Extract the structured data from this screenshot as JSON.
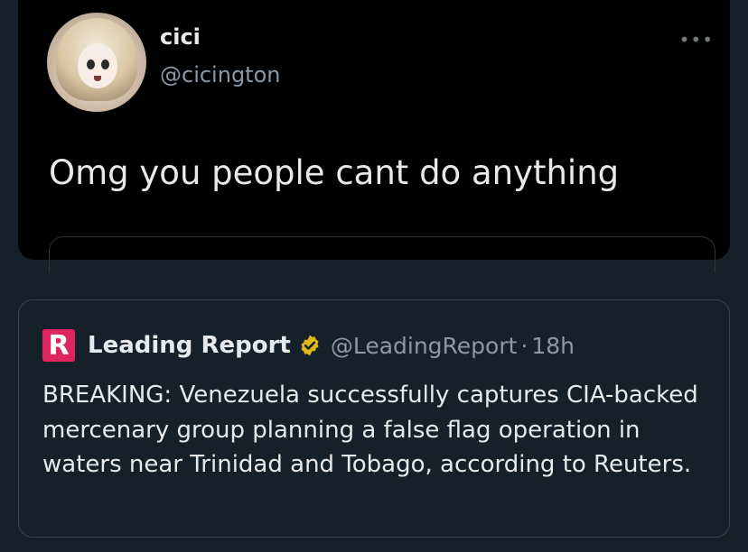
{
  "main_tweet": {
    "display_name": "cici",
    "handle": "@cicington",
    "text": "Omg you people cant do anything",
    "more_icon": "more-horizontal-icon"
  },
  "quoted_tweet": {
    "logo_icon": "leading-report-logo-icon",
    "logo_letter": "R",
    "display_name": "Leading Report",
    "verified_icon": "verified-badge-icon",
    "handle": "@LeadingReport",
    "separator": "·",
    "time": "18h",
    "text": "BREAKING: Venezuela successfully captures CIA-backed mercenary group planning a false flag operation in waters near Trinidad and Tobago, according to Reuters."
  },
  "colors": {
    "background": "#15202b",
    "card_black": "#000000",
    "primary_text": "#e7e9ea",
    "secondary_text": "#8b98a5",
    "verified_gold": "#e2b719",
    "logo_red": "#e0245e"
  }
}
